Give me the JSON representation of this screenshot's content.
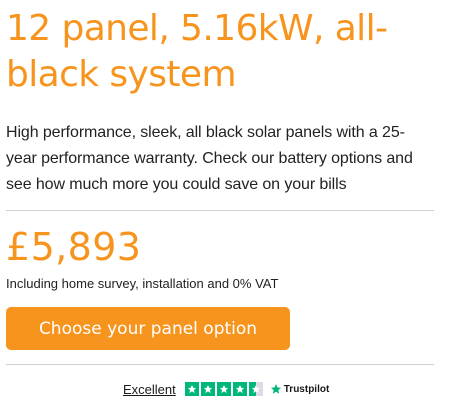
{
  "product": {
    "title": "12 panel, 5.16kW, all-black system",
    "description": "High performance, sleek, all black solar panels with a 25-year performance warranty. Check our battery options and see how much more you could save on your bills"
  },
  "pricing": {
    "price": "£5,893",
    "note": "Including home survey, installation and 0% VAT"
  },
  "cta": {
    "label": "Choose your panel option"
  },
  "trustpilot": {
    "rating_label": "Excellent",
    "rating_stars": 4.5,
    "brand": "Trustpilot"
  },
  "colors": {
    "accent": "#f7941d",
    "trustpilot_green": "#00b67a"
  }
}
